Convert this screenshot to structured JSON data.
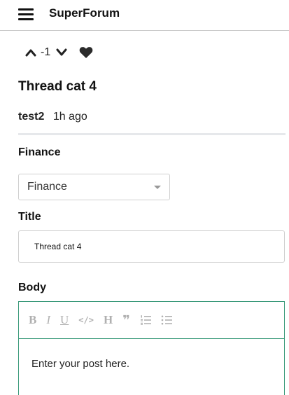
{
  "header": {
    "app_name": "SuperForum",
    "menu_icon": "hamburger-menu-icon"
  },
  "post": {
    "vote_count": "-1",
    "title": "Thread cat 4",
    "author": "test2",
    "posted_ago": "1h ago",
    "favorited": true
  },
  "form": {
    "category_label": "Finance",
    "category_selected": "Finance",
    "title_label": "Title",
    "title_value": "Thread cat 4",
    "body_label": "Body",
    "body_placeholder": "Enter your post here.",
    "editor_accent_color": "#3a9a7a"
  },
  "toolbar": {
    "bold_label": "B",
    "italic_label": "I",
    "underline_label": "U",
    "code_label": "</>",
    "heading_label": "H",
    "quote_label": "❞",
    "ordered_list_icon": "ordered-list-icon",
    "unordered_list_icon": "unordered-list-icon"
  }
}
